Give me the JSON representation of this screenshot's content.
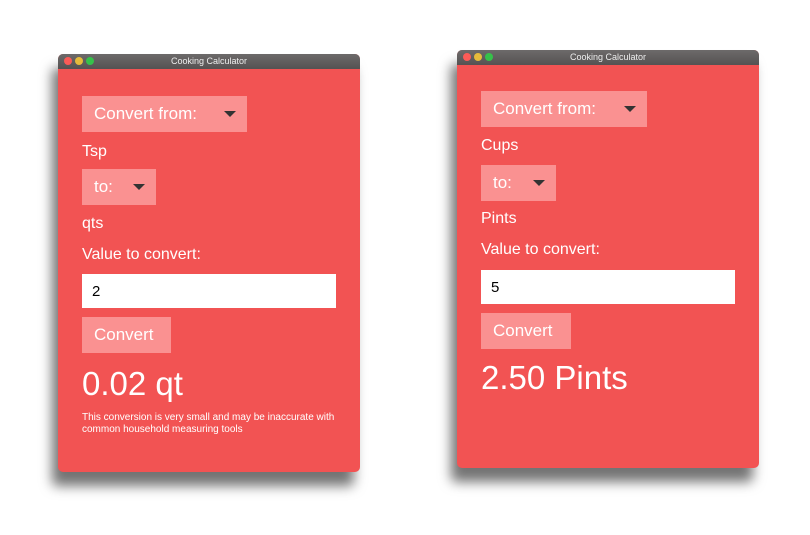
{
  "windows": [
    {
      "title": "Cooking Calculator",
      "convert_from_label": "Convert from:",
      "from_unit": "Tsp",
      "to_label": "to:",
      "to_unit": "qts",
      "value_label": "Value to convert:",
      "value_input": "2",
      "convert_button": "Convert",
      "result": "0.02 qt",
      "note": "This conversion is very small and may be inaccurate with common household measuring tools"
    },
    {
      "title": "Cooking Calculator",
      "convert_from_label": "Convert from:",
      "from_unit": "Cups",
      "to_label": "to:",
      "to_unit": "Pints",
      "value_label": "Value to convert:",
      "value_input": "5",
      "convert_button": "Convert",
      "result": "2.50 Pints"
    }
  ],
  "colors": {
    "window_bg": "#f25353",
    "button_bg": "#fa9191",
    "titlebar": "#5e5b5b",
    "text": "#ffffff"
  },
  "icons": {
    "dropdown": "caret-down-icon",
    "window_controls": [
      "close-dot-icon",
      "minimize-dot-icon",
      "maximize-dot-icon"
    ]
  }
}
